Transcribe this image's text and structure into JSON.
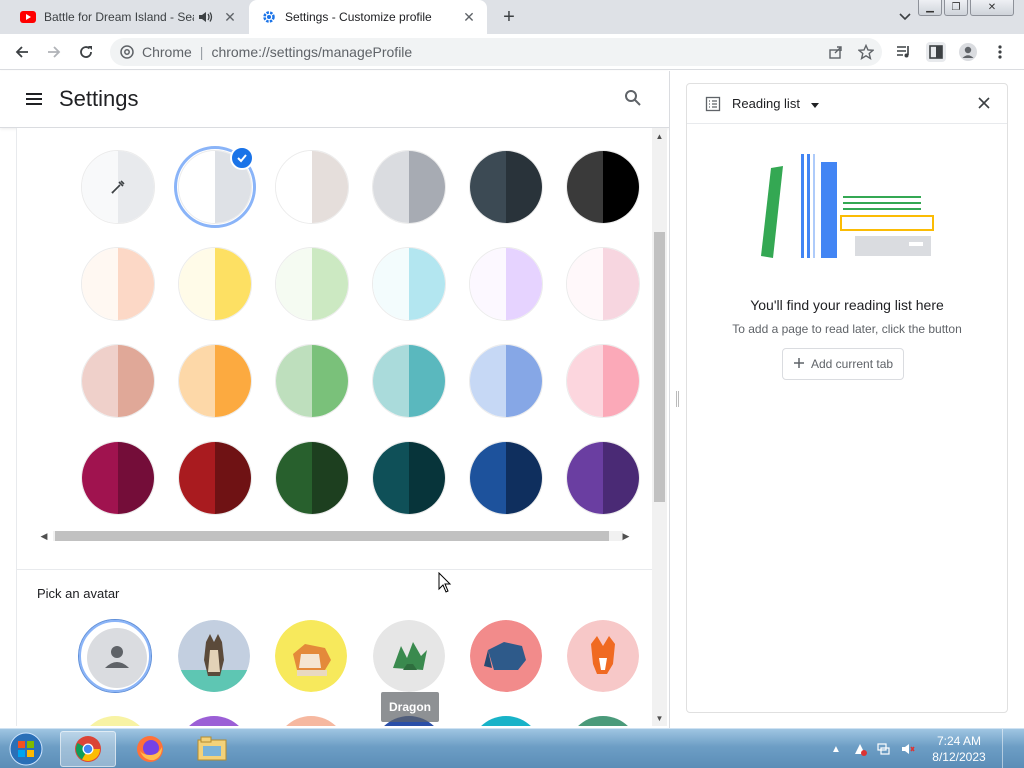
{
  "tabs": [
    {
      "title": "Battle for Dream Island - Sea",
      "active": false
    },
    {
      "title": "Settings - Customize profile",
      "active": true
    }
  ],
  "omnibox": {
    "label": "Chrome",
    "url": "chrome://settings/manageProfile"
  },
  "settings": {
    "title": "Settings"
  },
  "theme_colors": [
    [
      "#f8f9fa",
      "#e8eaed"
    ],
    [
      "#ffffff",
      "#dee1e6"
    ],
    [
      "#ffffff",
      "#e5dedb"
    ],
    [
      "#dadce0",
      "#a7abb3"
    ],
    [
      "#3c4a54",
      "#29333a"
    ],
    [
      "#3a3a3a",
      "#000000"
    ],
    [
      "#fff8f2",
      "#fcd8c6"
    ],
    [
      "#fffbe8",
      "#fde063"
    ],
    [
      "#f5fbf2",
      "#cce9c2"
    ],
    [
      "#f3fcfd",
      "#b3e6f0"
    ],
    [
      "#fcf8ff",
      "#e6d3ff"
    ],
    [
      "#fff8fa",
      "#f7d6e0"
    ],
    [
      "#efd0ca",
      "#e0a898"
    ],
    [
      "#fdd8a8",
      "#fcaa40"
    ],
    [
      "#bedfbd",
      "#7ac17a"
    ],
    [
      "#aadbdb",
      "#5ab8be"
    ],
    [
      "#c6d8f5",
      "#86a7e6"
    ],
    [
      "#fcd6de",
      "#fba9b8"
    ],
    [
      "#a0134f",
      "#740d39"
    ],
    [
      "#a91b1f",
      "#6f1214"
    ],
    [
      "#28602d",
      "#1d3f1f"
    ],
    [
      "#0f5058",
      "#07343a"
    ],
    [
      "#1d529c",
      "#0f2f5e"
    ],
    [
      "#6a3ea1",
      "#4a2a75"
    ]
  ],
  "avatar_section": {
    "title": "Pick an avatar",
    "tooltip": "Dragon"
  },
  "reading_list": {
    "title": "Reading list",
    "empty_title": "You'll find your reading list here",
    "empty_subtitle": "To add a page to read later, click the button",
    "add_button": "Add current tab"
  },
  "taskbar": {
    "time": "7:24 AM",
    "date": "8/12/2023"
  },
  "colors": {
    "accent": "#1a73e8"
  }
}
